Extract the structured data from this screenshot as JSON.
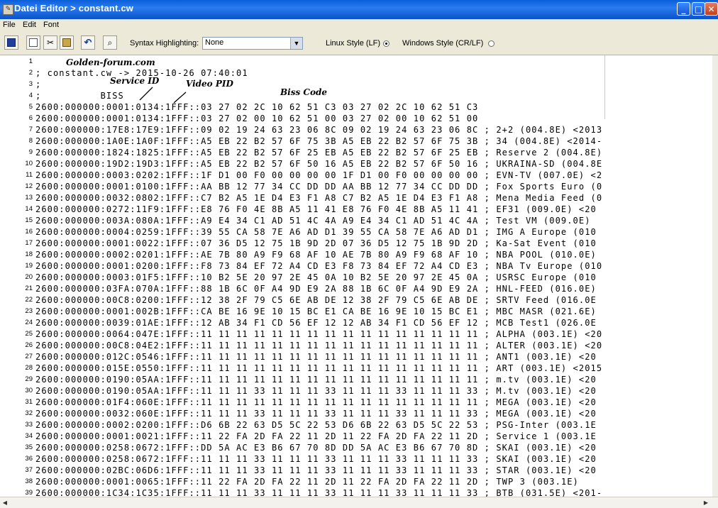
{
  "window": {
    "title": "Datei Editor > constant.cw",
    "minimize_glyph": "_",
    "maximize_glyph": "□",
    "close_glyph": "✕"
  },
  "menu": [
    "File",
    "Edit",
    "Font"
  ],
  "toolbar": {
    "syntax_label": "Syntax Highlighting:",
    "syntax_value": "None",
    "linux_label": "Linux Style (LF)",
    "windows_label": "Windows Style (CR/LF)",
    "selected_line_ending": "linux",
    "icons": [
      "save-icon",
      "copy-icon",
      "cut-icon",
      "paste-icon",
      "undo-icon",
      "find-icon"
    ]
  },
  "annotations": {
    "site": "Golden-forum.com",
    "service_id": "Service ID",
    "video_pid": "Video PID",
    "biss_code": "Biss Code"
  },
  "lines": [
    {
      "n": "1",
      "text": ""
    },
    {
      "n": "2",
      "text": "; constant.cw -> 2015-10-26 07:40:01"
    },
    {
      "n": "3",
      "text": ";"
    },
    {
      "n": "4",
      "text": ";          BISS"
    },
    {
      "n": "5",
      "text": "2600:000000:0001:0134:1FFF::03 27 02 2C 10 62 51 C3 03 27 02 2C 10 62 51 C3"
    },
    {
      "n": "6",
      "text": "2600:000000:0001:0134:1FFF::03 27 02 00 10 62 51 00 03 27 02 00 10 62 51 00"
    },
    {
      "n": "7",
      "text": "2600:000000:17E8:17E9:1FFF::09 02 19 24 63 23 06 8C 09 02 19 24 63 23 06 8C ; 2+2 (004.8E) <2013"
    },
    {
      "n": "8",
      "text": "2600:000000:1A0E:1A0F:1FFF::A5 EB 22 B2 57 6F 75 3B A5 EB 22 B2 57 6F 75 3B ; 34 (004.8E) <2014-"
    },
    {
      "n": "9",
      "text": "2600:000000:1824:1825:1FFF::A5 EB 22 B2 57 6F 25 EB A5 EB 22 B2 57 6F 25 EB ; Reserve 2 (004.8E)"
    },
    {
      "n": "10",
      "text": "2600:000000:19D2:19D3:1FFF::A5 EB 22 B2 57 6F 50 16 A5 EB 22 B2 57 6F 50 16 ; UKRAINA-SD (004.8E"
    },
    {
      "n": "11",
      "text": "2600:000000:0003:0202:1FFF::1F D1 00 F0 00 00 00 00 1F D1 00 F0 00 00 00 00 ; EVN-TV (007.0E) <2"
    },
    {
      "n": "12",
      "text": "2600:000000:0001:0100:1FFF::AA BB 12 77 34 CC DD DD AA BB 12 77 34 CC DD DD ; Fox Sports Euro (0"
    },
    {
      "n": "13",
      "text": "2600:000000:0032:0802:1FFF::C7 B2 A5 1E D4 E3 F1 A8 C7 B2 A5 1E D4 E3 F1 A8 ; Mena Media Feed (0"
    },
    {
      "n": "14",
      "text": "2600:000000:0272:11F9:1FFF::E8 76 F0 4E 8B A5 11 41 E8 76 F0 4E 8B A5 11 41 ; EF31 (009.0E) <20"
    },
    {
      "n": "15",
      "text": "2600:000000:003A:080A:1FFF::A9 E4 34 C1 AD 51 4C 4A A9 E4 34 C1 AD 51 4C 4A ; Test VM (009.0E)"
    },
    {
      "n": "16",
      "text": "2600:000000:0004:0259:1FFF::39 55 CA 58 7E A6 AD D1 39 55 CA 58 7E A6 AD D1 ; IMG A Europe (010"
    },
    {
      "n": "17",
      "text": "2600:000000:0001:0022:1FFF::07 36 D5 12 75 1B 9D 2D 07 36 D5 12 75 1B 9D 2D ; Ka-Sat Event (010"
    },
    {
      "n": "18",
      "text": "2600:000000:0002:0201:1FFF::AE 7B 80 A9 F9 68 AF 10 AE 7B 80 A9 F9 68 AF 10 ; NBA POOL (010.0E)"
    },
    {
      "n": "19",
      "text": "2600:000000:0001:0200:1FFF::F8 73 84 EF 72 A4 CD E3 F8 73 84 EF 72 A4 CD E3 ; NBA Tv Europe (010"
    },
    {
      "n": "20",
      "text": "2600:000000:0003:01F5:1FFF::10 B2 5E 20 97 2E 45 0A 10 B2 5E 20 97 2E 45 0A ; USRSC Europe (010"
    },
    {
      "n": "21",
      "text": "2600:000000:03FA:070A:1FFF::88 1B 6C 0F A4 9D E9 2A 88 1B 6C 0F A4 9D E9 2A ; HNL-FEED (016.0E)"
    },
    {
      "n": "22",
      "text": "2600:000000:00C8:0200:1FFF::12 38 2F 79 C5 6E AB DE 12 38 2F 79 C5 6E AB DE ; SRTV Feed (016.0E"
    },
    {
      "n": "23",
      "text": "2600:000000:0001:002B:1FFF::CA BE 16 9E 10 15 BC E1 CA BE 16 9E 10 15 BC E1 ; MBC MASR (021.6E)"
    },
    {
      "n": "24",
      "text": "2600:000000:0039:01AE:1FFF::12 AB 34 F1 CD 56 EF 12 12 AB 34 F1 CD 56 EF 12 ; MCB Test1 (026.0E"
    },
    {
      "n": "25",
      "text": "2600:000000:0064:047E:1FFF::11 11 11 11 11 11 11 11 11 11 11 11 11 11 11 11 ; ALPHA (003.1E) <20"
    },
    {
      "n": "26",
      "text": "2600:000000:00C8:04E2:1FFF::11 11 11 11 11 11 11 11 11 11 11 11 11 11 11 11 ; ALTER (003.1E) <20"
    },
    {
      "n": "27",
      "text": "2600:000000:012C:0546:1FFF::11 11 11 11 11 11 11 11 11 11 11 11 11 11 11 11 ; ANT1 (003.1E) <20"
    },
    {
      "n": "28",
      "text": "2600:000000:015E:0550:1FFF::11 11 11 11 11 11 11 11 11 11 11 11 11 11 11 11 ; ART (003.1E) <2015"
    },
    {
      "n": "29",
      "text": "2600:000000:0190:05AA:1FFF::11 11 11 11 11 11 11 11 11 11 11 11 11 11 11 11 ; m.tv (003.1E) <20"
    },
    {
      "n": "30",
      "text": "2600:000000:0190:05AA:1FFF::11 11 11 33 11 11 11 33 11 11 11 33 11 11 11 33 ; M.tv (003.1E) <20"
    },
    {
      "n": "31",
      "text": "2600:000000:01F4:060E:1FFF::11 11 11 11 11 11 11 11 11 11 11 11 11 11 11 11 ; MEGA (003.1E) <20"
    },
    {
      "n": "32",
      "text": "2600:000000:0032:060E:1FFF::11 11 11 33 11 11 11 33 11 11 11 33 11 11 11 33 ; MEGA (003.1E) <20"
    },
    {
      "n": "33",
      "text": "2600:000000:0002:0200:1FFF::D6 6B 22 63 D5 5C 22 53 D6 6B 22 63 D5 5C 22 53 ; PSG-Inter (003.1E"
    },
    {
      "n": "34",
      "text": "2600:000000:0001:0021:1FFF::11 22 FA 2D FA 22 11 2D 11 22 FA 2D FA 22 11 2D ; Service 1 (003.1E"
    },
    {
      "n": "35",
      "text": "2600:000000:0258:0672:1FFF::DD 5A AC E3 B6 67 70 8D DD 5A AC E3 B6 67 70 8D ; SKAI (003.1E) <20"
    },
    {
      "n": "36",
      "text": "2600:000000:0258:0672:1FFF::11 11 11 33 11 11 11 33 11 11 11 33 11 11 11 33 ; SKAI (003.1E) <20"
    },
    {
      "n": "37",
      "text": "2600:000000:02BC:06D6:1FFF::11 11 11 33 11 11 11 33 11 11 11 33 11 11 11 33 ; STAR (003.1E) <20"
    },
    {
      "n": "38",
      "text": "2600:000000:0001:0065:1FFF::11 22 FA 2D FA 22 11 2D 11 22 FA 2D FA 22 11 2D ; TWP 3 (003.1E)"
    },
    {
      "n": "39",
      "text": "2600:000000:1C34:1C35:1FFF::11 11 11 33 11 11 11 33 11 11 11 33 11 11 11 33 ; BTB (031.5E) <201-"
    }
  ]
}
